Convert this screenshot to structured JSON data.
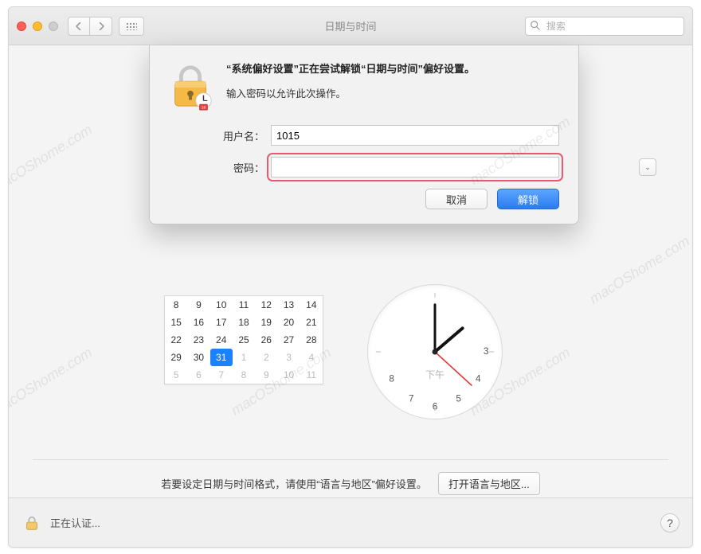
{
  "toolbar": {
    "title": "日期与时间",
    "search_placeholder": "搜索"
  },
  "dropdown_icon": "⌄",
  "dialog": {
    "headline": "“系统偏好设置”正在尝试解锁“日期与时间”偏好设置。",
    "sub": "输入密码以允许此次操作。",
    "username_label": "用户名：",
    "username_value": "1015",
    "password_label": "密码：",
    "password_value": "",
    "cancel": "取消",
    "unlock": "解锁"
  },
  "calendar": {
    "rows": [
      [
        {
          "t": "8"
        },
        {
          "t": "9"
        },
        {
          "t": "10"
        },
        {
          "t": "11"
        },
        {
          "t": "12"
        },
        {
          "t": "13"
        },
        {
          "t": "14"
        }
      ],
      [
        {
          "t": "15"
        },
        {
          "t": "16"
        },
        {
          "t": "17"
        },
        {
          "t": "18"
        },
        {
          "t": "19"
        },
        {
          "t": "20"
        },
        {
          "t": "21"
        }
      ],
      [
        {
          "t": "22"
        },
        {
          "t": "23"
        },
        {
          "t": "24"
        },
        {
          "t": "25"
        },
        {
          "t": "26"
        },
        {
          "t": "27"
        },
        {
          "t": "28"
        }
      ],
      [
        {
          "t": "29"
        },
        {
          "t": "30"
        },
        {
          "t": "31",
          "sel": true
        },
        {
          "t": "1",
          "dim": true
        },
        {
          "t": "2",
          "dim": true
        },
        {
          "t": "3",
          "dim": true
        },
        {
          "t": "4",
          "dim": true
        }
      ],
      [
        {
          "t": "5",
          "dim": true
        },
        {
          "t": "6",
          "dim": true
        },
        {
          "t": "7",
          "dim": true
        },
        {
          "t": "8",
          "dim": true
        },
        {
          "t": "9",
          "dim": true
        },
        {
          "t": "10",
          "dim": true
        },
        {
          "t": "11",
          "dim": true
        }
      ]
    ]
  },
  "clock": {
    "hours": [
      "3",
      "4",
      "5",
      "6",
      "7",
      "8"
    ],
    "pm_label": "下午"
  },
  "format": {
    "text": "若要设定日期与时间格式，请使用“语言与地区”偏好设置。",
    "button": "打开语言与地区..."
  },
  "footer": {
    "status": "正在认证...",
    "help": "?"
  },
  "watermark": "macOShome.com"
}
